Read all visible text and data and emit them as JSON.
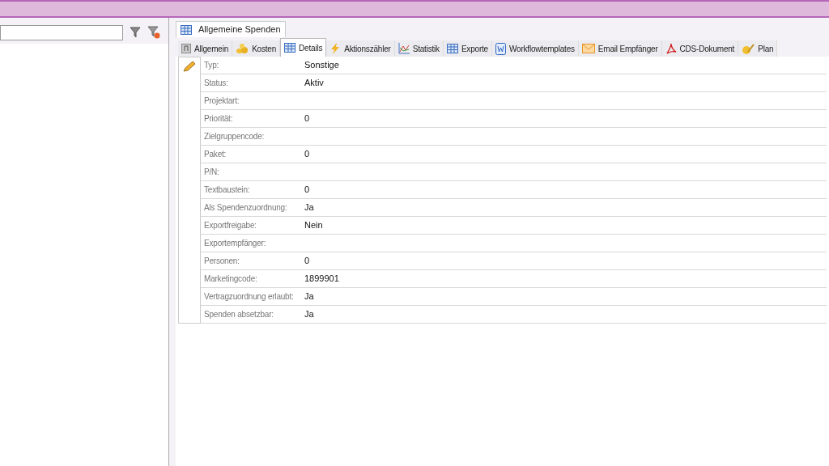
{
  "document_tab": {
    "title": "Allgemeine Spenden"
  },
  "tabs": [
    {
      "label": "Allgemein",
      "selected": false
    },
    {
      "label": "Kosten",
      "selected": false
    },
    {
      "label": "Details",
      "selected": true
    },
    {
      "label": "Aktionszähler",
      "selected": false
    },
    {
      "label": "Statistik",
      "selected": false
    },
    {
      "label": "Exporte",
      "selected": false
    },
    {
      "label": "Workflowtemplates",
      "selected": false
    },
    {
      "label": "Email Empfänger",
      "selected": false
    },
    {
      "label": "CDS-Dokument",
      "selected": false
    },
    {
      "label": "Plan",
      "selected": false
    }
  ],
  "properties": [
    {
      "label": "Typ:",
      "value": "Sonstige"
    },
    {
      "label": "Status:",
      "value": "Aktiv"
    },
    {
      "label": "Projektart:"
    },
    {
      "label": "Priorität:",
      "value": "0"
    },
    {
      "label": "Zielgruppencode:"
    },
    {
      "label": "Paket:",
      "value": "0"
    },
    {
      "label": "P/N:"
    },
    {
      "label": "Textbaustein:",
      "value": "0"
    },
    {
      "label": "Als Spendenzuordnung:",
      "value": "Ja"
    },
    {
      "label": "Exportfreigabe:",
      "value": "Nein"
    },
    {
      "label": "Exportempfänger:"
    },
    {
      "label": "Personen:",
      "value": "0"
    },
    {
      "label": "Marketingcode:",
      "value": "1899901"
    },
    {
      "label": "Vertragzuordnung erlaubt:",
      "value": "Ja"
    },
    {
      "label": "Spenden absetzbar:",
      "value": "Ja"
    }
  ]
}
